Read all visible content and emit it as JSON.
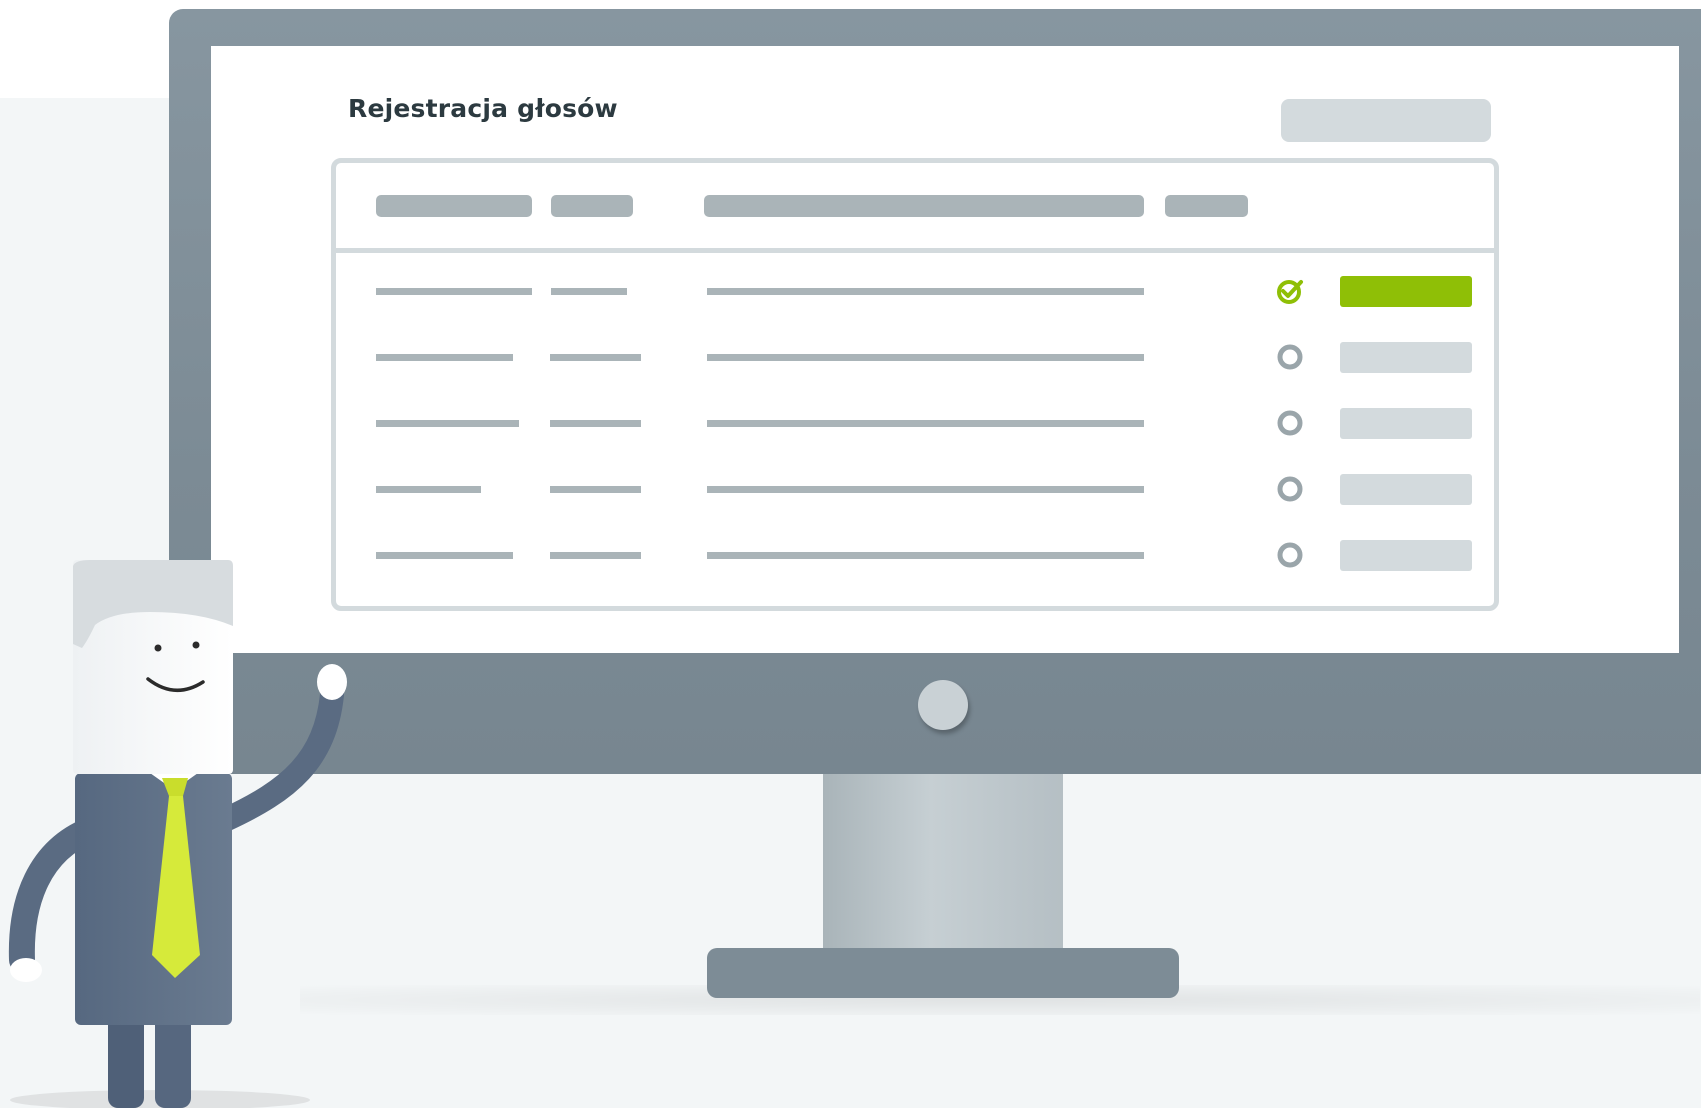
{
  "screen": {
    "title": "Rejestracja głosów"
  },
  "table": {
    "rows": [
      {
        "status": "checked"
      },
      {
        "status": "unchecked"
      },
      {
        "status": "unchecked"
      },
      {
        "status": "unchecked"
      },
      {
        "status": "unchecked"
      }
    ]
  },
  "colors": {
    "accent": "#8fbf06",
    "placeholder": "#aab4b8",
    "placeholder_light": "#d3dadd",
    "bezel": "#7d8c96",
    "title": "#2c3a40",
    "mascot_suit": "#5d6f85",
    "mascot_tie": "#d6ea3a"
  },
  "icons": {
    "checked": "check-circle-icon",
    "unchecked": "empty-circle-icon"
  }
}
